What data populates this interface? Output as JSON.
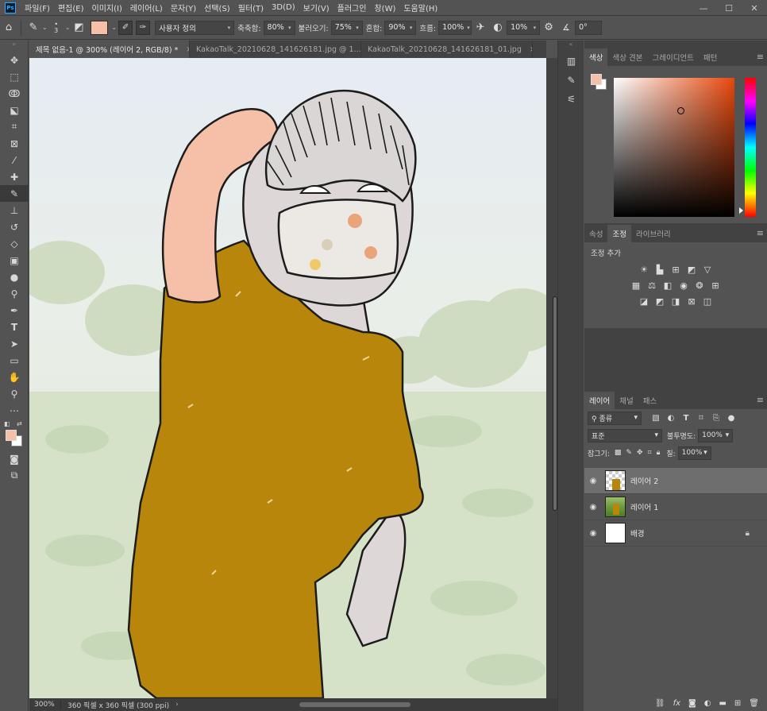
{
  "app": {
    "logo": "Ps",
    "menus": [
      "파일(F)",
      "편집(E)",
      "이미지(I)",
      "레이어(L)",
      "문자(Y)",
      "선택(S)",
      "필터(T)",
      "3D(D)",
      "보기(V)",
      "플러그인",
      "창(W)",
      "도움말(H)"
    ],
    "window_controls": [
      "—",
      "☐",
      "✕"
    ]
  },
  "options": {
    "brush_size": "3",
    "preset": "사용자 정의",
    "moisture_label": "축축함:",
    "moisture": "80%",
    "load_label": "불러오기:",
    "load": "75%",
    "mix_label": "혼합:",
    "mix": "90%",
    "flow_label": "흐름:",
    "flow": "100%",
    "smoothing": "10%",
    "angle": "0°"
  },
  "tabs": [
    {
      "label": "제목 없음-1 @ 300% (레이어 2, RGB/8) *",
      "close": "×"
    },
    {
      "label": "KakaoTalk_20210628_141626181.jpg @ 1...",
      "close": "×"
    },
    {
      "label": "KakaoTalk_20210628_141626181_01.jpg",
      "close": "×"
    }
  ],
  "status": {
    "zoom": "300%",
    "doc_info": "360 픽셀 x 360 픽셀 (300 ppi)",
    "arrow": "›"
  },
  "color_panel": {
    "tabs": [
      "색상",
      "색상 견본",
      "그레이디언트",
      "패턴"
    ],
    "foreground": "#f6bfa8",
    "background": "#ffffff"
  },
  "adjust_panel": {
    "tabs": [
      "속성",
      "조정",
      "라이브러리"
    ],
    "title": "조정 추가"
  },
  "layers_panel": {
    "tabs": [
      "레이어",
      "채널",
      "패스"
    ],
    "filter_kind": "종류",
    "blend_mode": "표준",
    "opacity_label": "불투명도:",
    "opacity": "100%",
    "lock_label": "잠그기:",
    "fill_label": "칠:",
    "fill": "100%",
    "layers": [
      {
        "name": "레이어 2",
        "selected": true
      },
      {
        "name": "레이어 1",
        "selected": false
      },
      {
        "name": "배경",
        "selected": false,
        "locked": true
      }
    ]
  },
  "colors": {
    "shirt": "#b8860b",
    "skin": "#f6bfa8",
    "accent": "#31a8ff"
  }
}
